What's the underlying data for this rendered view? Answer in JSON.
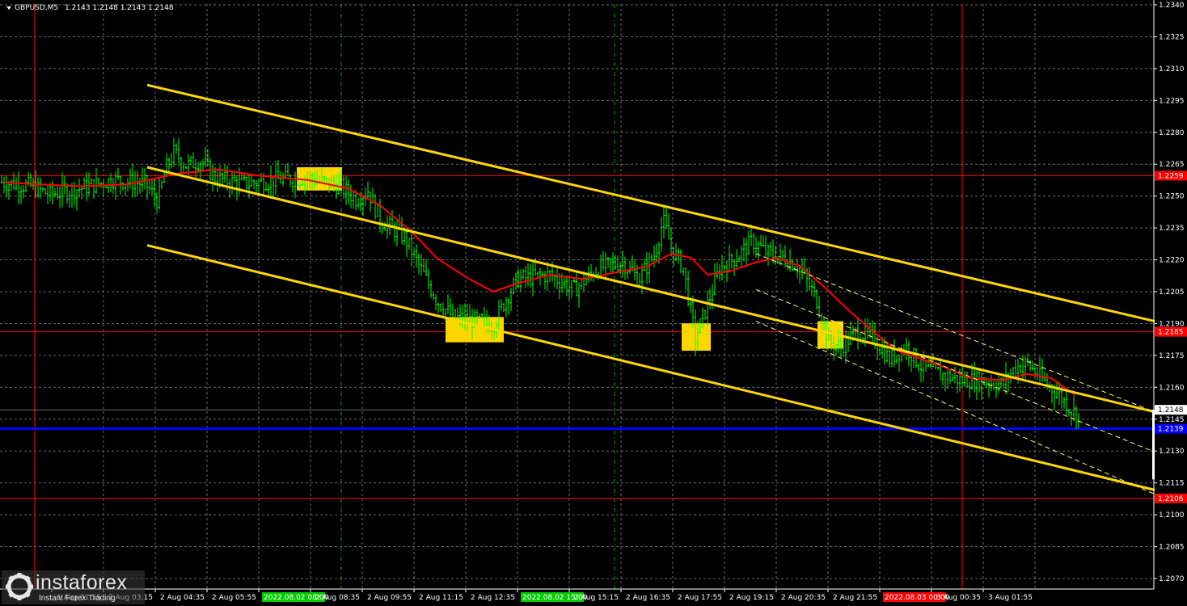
{
  "header": {
    "symbol": "GBPUSD,M5",
    "ohlc": "1.2143 1.2148 1.2143 1.2148"
  },
  "watermark": {
    "brand": "instaforex",
    "tagline": "Instant Forex Trading"
  },
  "colors": {
    "background": "#000000",
    "grid": "#6b6b6b",
    "candles": "#00ff00",
    "sma": "#ff0000",
    "channel": "#ffd700",
    "channel_dashed": "#ffff66",
    "support_line": "#ff0000",
    "current_level": "#0000ff",
    "session_marker": "#ff0000",
    "day_marker": "#00aa00",
    "signal_box": "#ffd700"
  },
  "chart_data": {
    "type": "candlestick",
    "instrument": "GBPUSD",
    "timeframe": "M5",
    "ylim": [
      1.2068,
      1.234
    ],
    "y_ticks": [
      "1.2340",
      "1.2325",
      "1.2310",
      "1.2295",
      "1.2280",
      "1.2265",
      "1.2250",
      "1.2235",
      "1.2220",
      "1.2205",
      "1.2190",
      "1.2175",
      "1.2160",
      "1.2145",
      "1.2130",
      "1.2115",
      "1.2100",
      "1.2085",
      "1.2070"
    ],
    "x_ticks": [
      "1 Aug 01:55",
      "2 Aug 03:15",
      "2 Aug 04:35",
      "2 Aug 05:55",
      "2022.08.02 08:00",
      "2 Aug 08:35",
      "2 Aug 09:55",
      "2 Aug 11:15",
      "2 Aug 12:35",
      "2022.08.02 15:00",
      "2 Aug 15:15",
      "2 Aug 16:35",
      "2 Aug 17:55",
      "2 Aug 19:15",
      "2 Aug 20:35",
      "2 Aug 21:55",
      "2022.08.03 00:00",
      "3 Aug 00:35",
      "3 Aug 01:55"
    ],
    "x_tick_highlights": {
      "2022.08.02 08:00": "#00cc00",
      "2022.08.02 15:00": "#00cc00",
      "2022.08.03 00:00": "#ff0000"
    },
    "price_path": [
      [
        0,
        1.2256
      ],
      [
        40,
        1.2254
      ],
      [
        60,
        1.225
      ],
      [
        100,
        1.2253
      ],
      [
        140,
        1.2257
      ],
      [
        180,
        1.2255
      ],
      [
        195,
        1.2247
      ],
      [
        205,
        1.2262
      ],
      [
        215,
        1.227
      ],
      [
        230,
        1.2264
      ],
      [
        250,
        1.2266
      ],
      [
        265,
        1.2258
      ],
      [
        300,
        1.2255
      ],
      [
        340,
        1.2257
      ],
      [
        380,
        1.2258
      ],
      [
        420,
        1.2254
      ],
      [
        440,
        1.2248
      ],
      [
        455,
        1.2252
      ],
      [
        470,
        1.2238
      ],
      [
        500,
        1.223
      ],
      [
        520,
        1.2215
      ],
      [
        540,
        1.22
      ],
      [
        560,
        1.2192
      ],
      [
        590,
        1.219
      ],
      [
        610,
        1.2188
      ],
      [
        625,
        1.22
      ],
      [
        640,
        1.221
      ],
      [
        680,
        1.2212
      ],
      [
        710,
        1.2205
      ],
      [
        740,
        1.2215
      ],
      [
        770,
        1.2218
      ],
      [
        790,
        1.221
      ],
      [
        810,
        1.2222
      ],
      [
        820,
        1.2238
      ],
      [
        830,
        1.2225
      ],
      [
        845,
        1.2215
      ],
      [
        860,
        1.2182
      ],
      [
        875,
        1.2198
      ],
      [
        890,
        1.2215
      ],
      [
        910,
        1.222
      ],
      [
        930,
        1.2228
      ],
      [
        950,
        1.2222
      ],
      [
        970,
        1.222
      ],
      [
        990,
        1.2215
      ],
      [
        1010,
        1.22
      ],
      [
        1025,
        1.218
      ],
      [
        1040,
        1.2178
      ],
      [
        1060,
        1.2185
      ],
      [
        1080,
        1.2182
      ],
      [
        1100,
        1.2172
      ],
      [
        1120,
        1.2178
      ],
      [
        1140,
        1.2168
      ],
      [
        1160,
        1.2165
      ],
      [
        1190,
        1.2162
      ],
      [
        1210,
        1.2162
      ],
      [
        1240,
        1.216
      ],
      [
        1255,
        1.2168
      ],
      [
        1270,
        1.217
      ],
      [
        1290,
        1.2162
      ],
      [
        1310,
        1.2155
      ],
      [
        1325,
        1.2148
      ],
      [
        1335,
        1.2145
      ]
    ],
    "sma_path": [
      [
        5,
        1.2256
      ],
      [
        40,
        1.2255
      ],
      [
        100,
        1.2254
      ],
      [
        160,
        1.2255
      ],
      [
        220,
        1.226
      ],
      [
        270,
        1.2262
      ],
      [
        320,
        1.2259
      ],
      [
        380,
        1.2257
      ],
      [
        430,
        1.2253
      ],
      [
        470,
        1.2245
      ],
      [
        510,
        1.2232
      ],
      [
        540,
        1.222
      ],
      [
        580,
        1.221
      ],
      [
        610,
        1.2204
      ],
      [
        640,
        1.2208
      ],
      [
        680,
        1.2212
      ],
      [
        720,
        1.221
      ],
      [
        760,
        1.2213
      ],
      [
        800,
        1.2216
      ],
      [
        830,
        1.2222
      ],
      [
        855,
        1.222
      ],
      [
        875,
        1.2212
      ],
      [
        905,
        1.2214
      ],
      [
        935,
        1.2218
      ],
      [
        960,
        1.222
      ],
      [
        990,
        1.2216
      ],
      [
        1020,
        1.2206
      ],
      [
        1050,
        1.2195
      ],
      [
        1080,
        1.2185
      ],
      [
        1110,
        1.2176
      ],
      [
        1140,
        1.2172
      ],
      [
        1170,
        1.2168
      ],
      [
        1200,
        1.2163
      ],
      [
        1240,
        1.2162
      ],
      [
        1270,
        1.2165
      ],
      [
        1300,
        1.2163
      ],
      [
        1330,
        1.2155
      ]
    ],
    "channel_lines": [
      {
        "style": "solid",
        "from": [
          182,
          1.2302
        ],
        "to": [
          1428,
          1.219
        ]
      },
      {
        "style": "solid",
        "from": [
          182,
          1.2263
        ],
        "to": [
          1428,
          1.2147
        ]
      },
      {
        "style": "solid",
        "from": [
          182,
          1.2226
        ],
        "to": [
          1428,
          1.211
        ]
      },
      {
        "style": "dashed",
        "from": [
          935,
          1.2222
        ],
        "to": [
          1428,
          1.2147
        ]
      },
      {
        "style": "dashed",
        "from": [
          935,
          1.2205
        ],
        "to": [
          1428,
          1.2128
        ]
      },
      {
        "style": "dashed",
        "from": [
          935,
          1.219
        ],
        "to": [
          1428,
          1.2108
        ]
      }
    ],
    "horizontal_levels": [
      {
        "price": 1.2259,
        "label": "1.2259",
        "kind": "resistance"
      },
      {
        "price": 1.2185,
        "label": "1.2185",
        "kind": "resistance"
      },
      {
        "price": 1.2106,
        "label": "1.2106",
        "kind": "support"
      },
      {
        "price": 1.2139,
        "label": "1.2139",
        "kind": "current"
      },
      {
        "price": 1.2148,
        "label": "1.2148",
        "kind": "last_price"
      }
    ],
    "signal_boxes": [
      {
        "x0": 367,
        "x1": 423,
        "y_top": 1.2263,
        "y_bot": 1.2252
      },
      {
        "x0": 551,
        "x1": 623,
        "y_top": 1.2192,
        "y_bot": 1.218
      },
      {
        "x0": 843,
        "x1": 879,
        "y_top": 1.2189,
        "y_bot": 1.2176
      },
      {
        "x0": 1011,
        "x1": 1043,
        "y_top": 1.219,
        "y_bot": 1.2177
      }
    ],
    "vertical_markers": [
      {
        "x": 43,
        "kind": "session"
      },
      {
        "x": 422,
        "kind": "day"
      },
      {
        "x": 760,
        "kind": "day"
      },
      {
        "x": 1190,
        "kind": "session"
      }
    ]
  }
}
